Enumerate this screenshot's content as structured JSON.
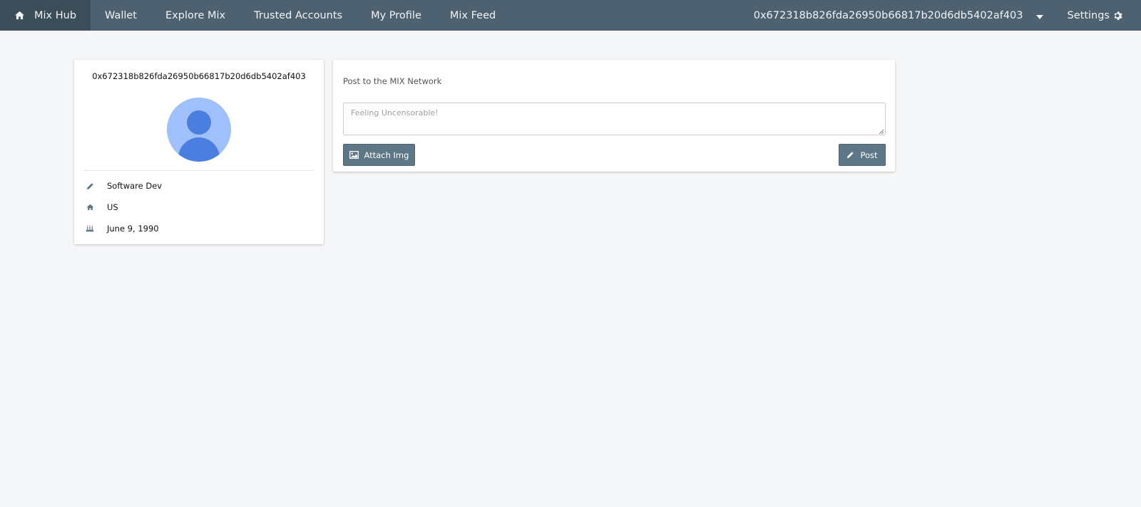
{
  "navbar": {
    "items": [
      {
        "label": "Mix Hub",
        "icon": "home-icon",
        "active": true
      },
      {
        "label": "Wallet"
      },
      {
        "label": "Explore Mix"
      },
      {
        "label": "Trusted Accounts"
      },
      {
        "label": "My Profile"
      },
      {
        "label": "Mix Feed"
      }
    ],
    "account_address": "0x672318b826fda26950b66817b20d6db5402af403",
    "settings_label": "Settings",
    "colors": {
      "background": "#4e6170",
      "active": "#3c4d5a"
    }
  },
  "profile": {
    "address": "0x672318b826fda26950b66817b20d6db5402af403",
    "avatar_icon": "user-avatar-icon",
    "occupation": "Software Dev",
    "location": "US",
    "birthday": "June 9, 1990"
  },
  "post": {
    "heading": "Post to the MIX Network",
    "placeholder": "Feeling Uncensorable!",
    "attach_label": "Attach Img",
    "post_label": "Post",
    "button_color": "#5e7786"
  }
}
